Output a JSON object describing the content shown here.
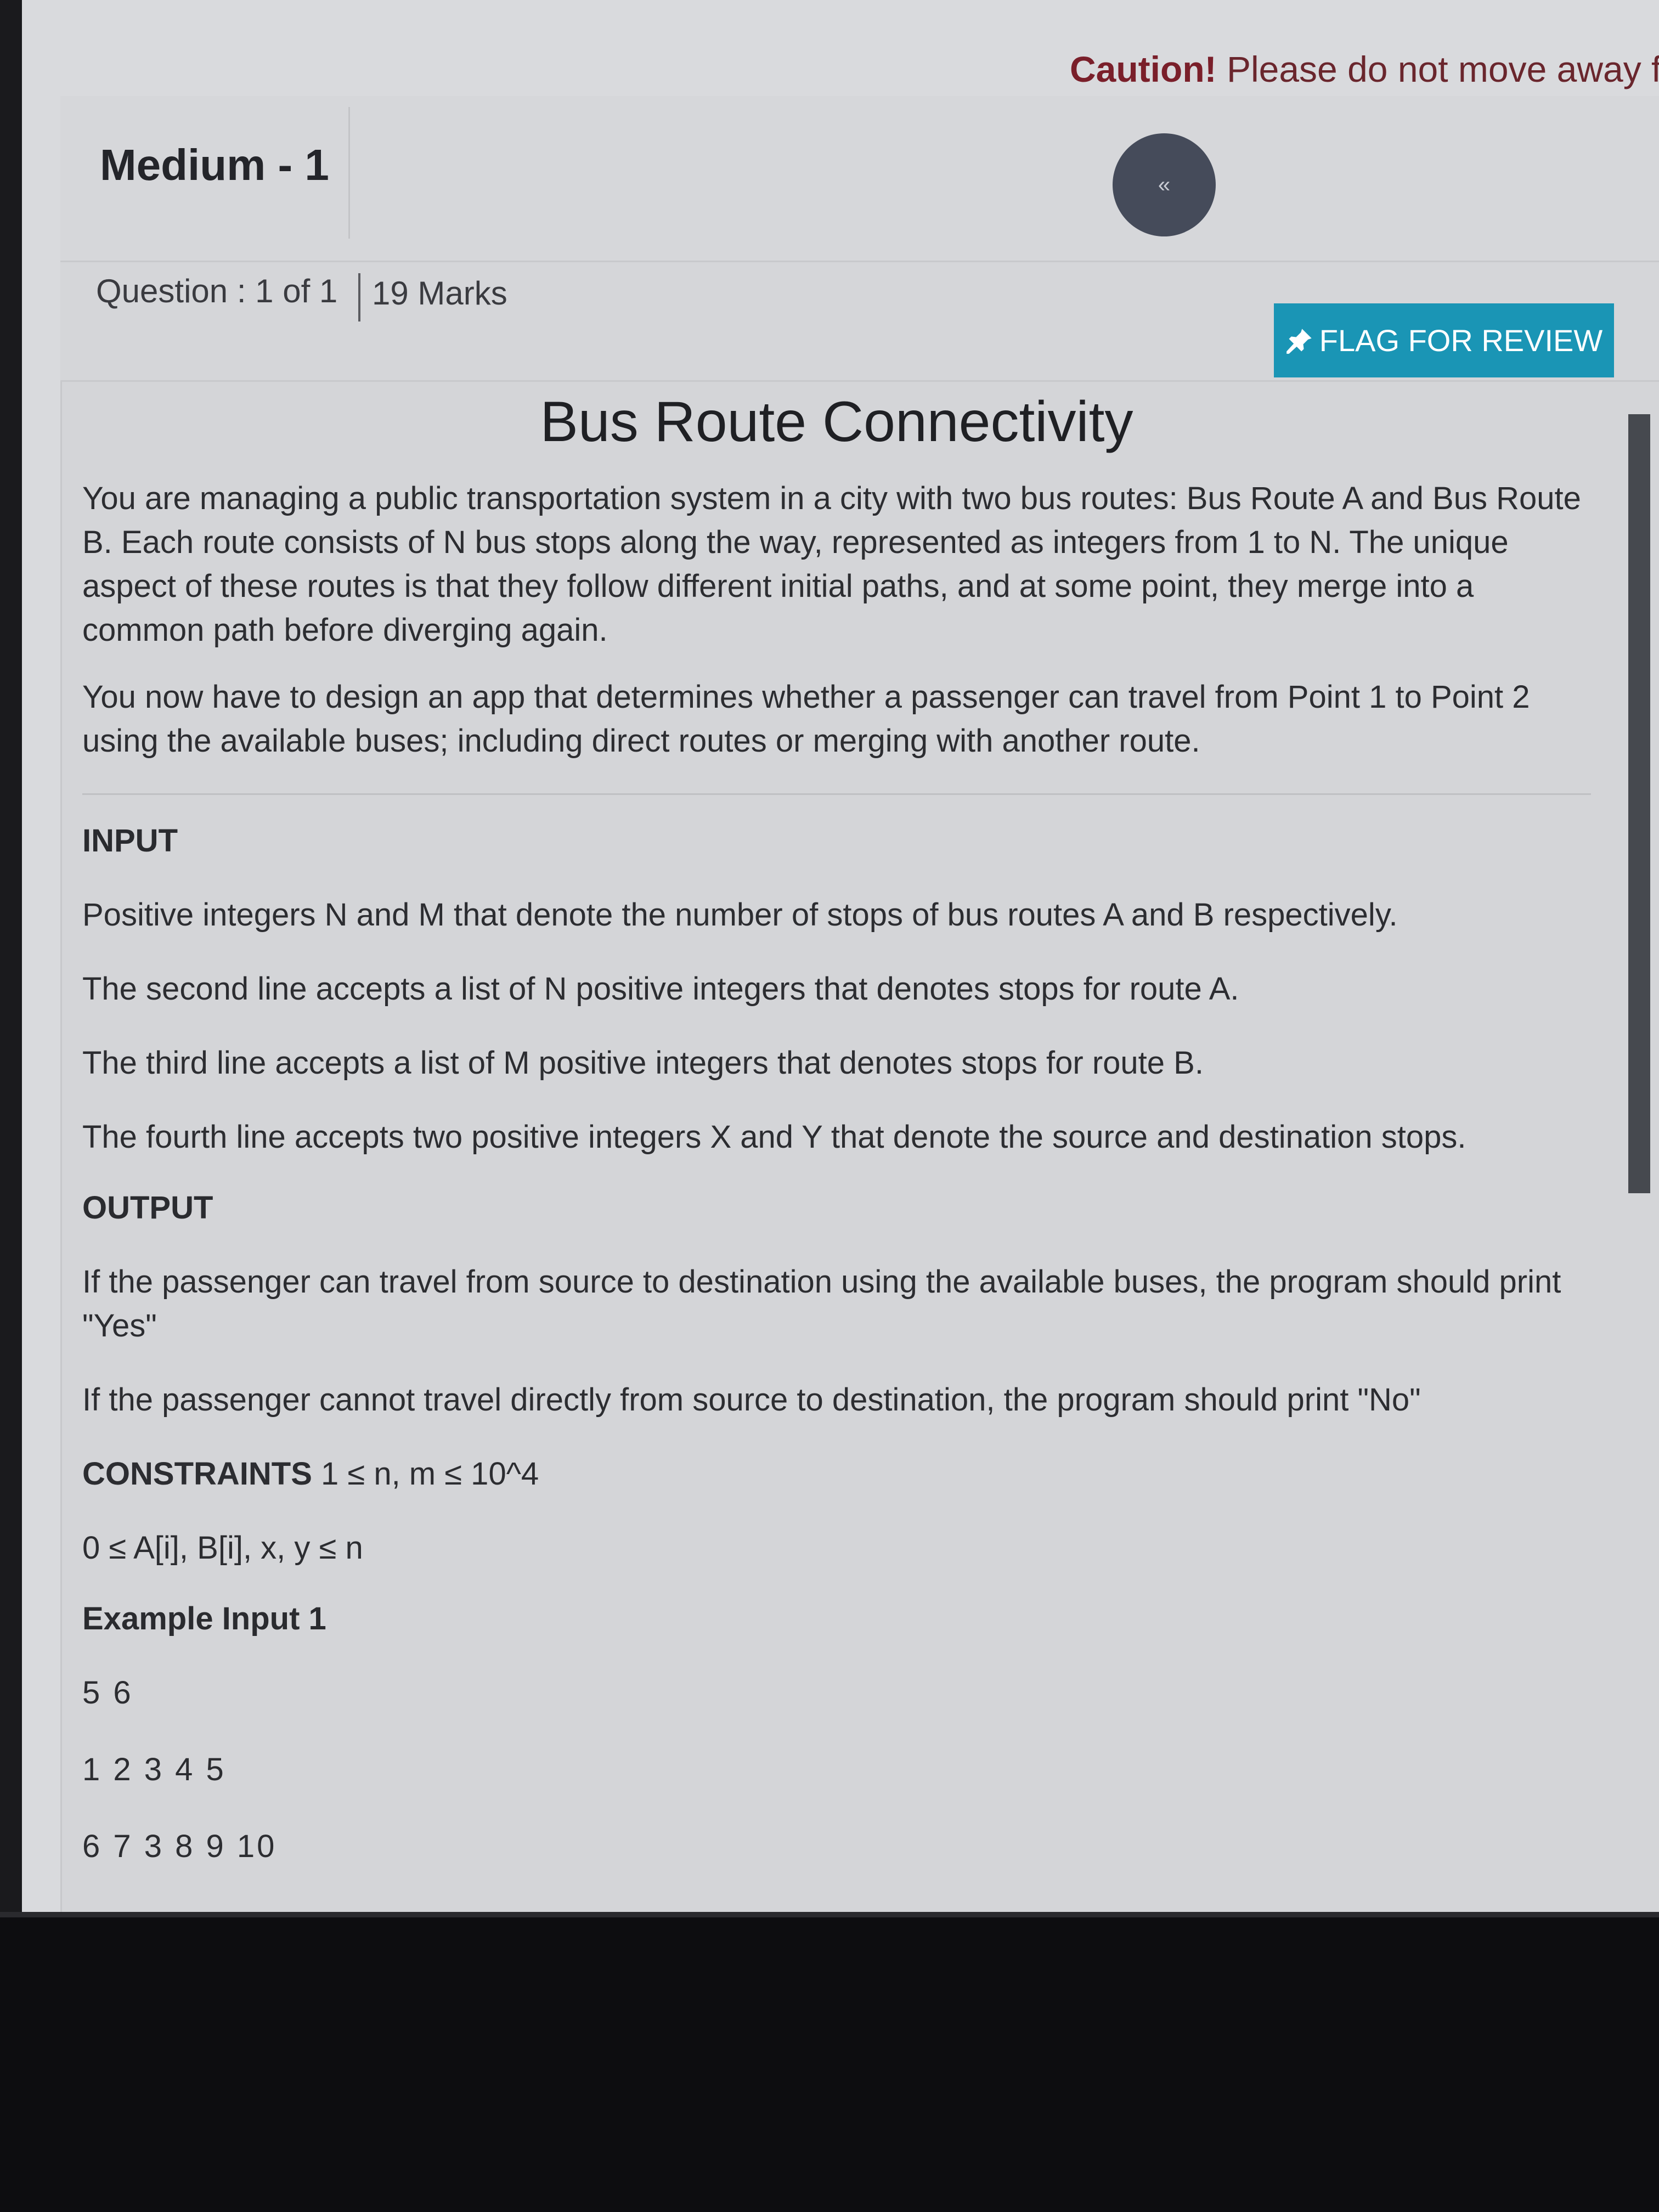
{
  "header": {
    "caution_bold": "Caution!",
    "caution_text": " Please do not move away fro",
    "section_title": "Medium - 1",
    "collapse_icon": "«"
  },
  "meta": {
    "question_counter": "Question : 1 of 1",
    "marks": "19 Marks",
    "flag_icon": "📌",
    "flag_label": "FLAG FOR REVIEW"
  },
  "problem": {
    "title": "Bus Route Connectivity",
    "description": [
      "You are managing a public transportation system in a city with two bus routes: Bus Route A and Bus Route B. Each route consists of N bus stops along the way, represented as integers from 1 to N. The unique aspect of these routes is that they follow different initial paths, and at some point, they merge into a common path before diverging again.",
      "You now have to design an app that determines whether a passenger can travel from Point 1 to Point 2 using the available buses; including direct routes or merging with another route."
    ],
    "input_heading": "INPUT",
    "input_lines": [
      "Positive integers N and M that denote the number of stops of bus routes A and B respectively.",
      "The second line accepts a list of N positive integers that denotes stops for route A.",
      "The third line accepts a list of M positive integers that denotes stops for route B.",
      "The fourth line accepts two positive integers X and Y that denote the source and destination stops."
    ],
    "output_heading": "OUTPUT",
    "output_lines": [
      "If the passenger can travel from source to destination using the available buses, the program should print \"Yes\"",
      "If the passenger cannot travel directly from source to destination, the program should print \"No\""
    ],
    "constraints_heading": "CONSTRAINTS",
    "constraints_first": " 1 ≤ n, m ≤ 10^4",
    "constraints_second": "0 ≤ A[i], B[i], x, y ≤ n",
    "example_heading": "Example Input 1",
    "example_lines": [
      "5 6",
      "1 2 3 4 5",
      "6 7 3 8 9 10"
    ]
  }
}
